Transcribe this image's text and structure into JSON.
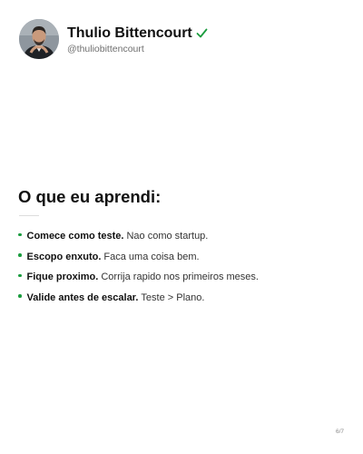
{
  "profile": {
    "name": "Thulio Bittencourt",
    "handle": "@thuliobittencourt",
    "verified_color": "#1a9c3e"
  },
  "content": {
    "heading": "O que eu aprendi:",
    "bullet_color": "#1a9c3e",
    "items": [
      {
        "bold": "Comece como teste.",
        "text": "Nao como startup."
      },
      {
        "bold": "Escopo enxuto.",
        "text": "Faca uma coisa bem."
      },
      {
        "bold": "Fique proximo.",
        "text": "Corrija rapido nos primeiros meses."
      },
      {
        "bold": "Valide antes de escalar.",
        "text": "Teste > Plano."
      }
    ]
  },
  "footer": {
    "page_number": "6/7"
  }
}
